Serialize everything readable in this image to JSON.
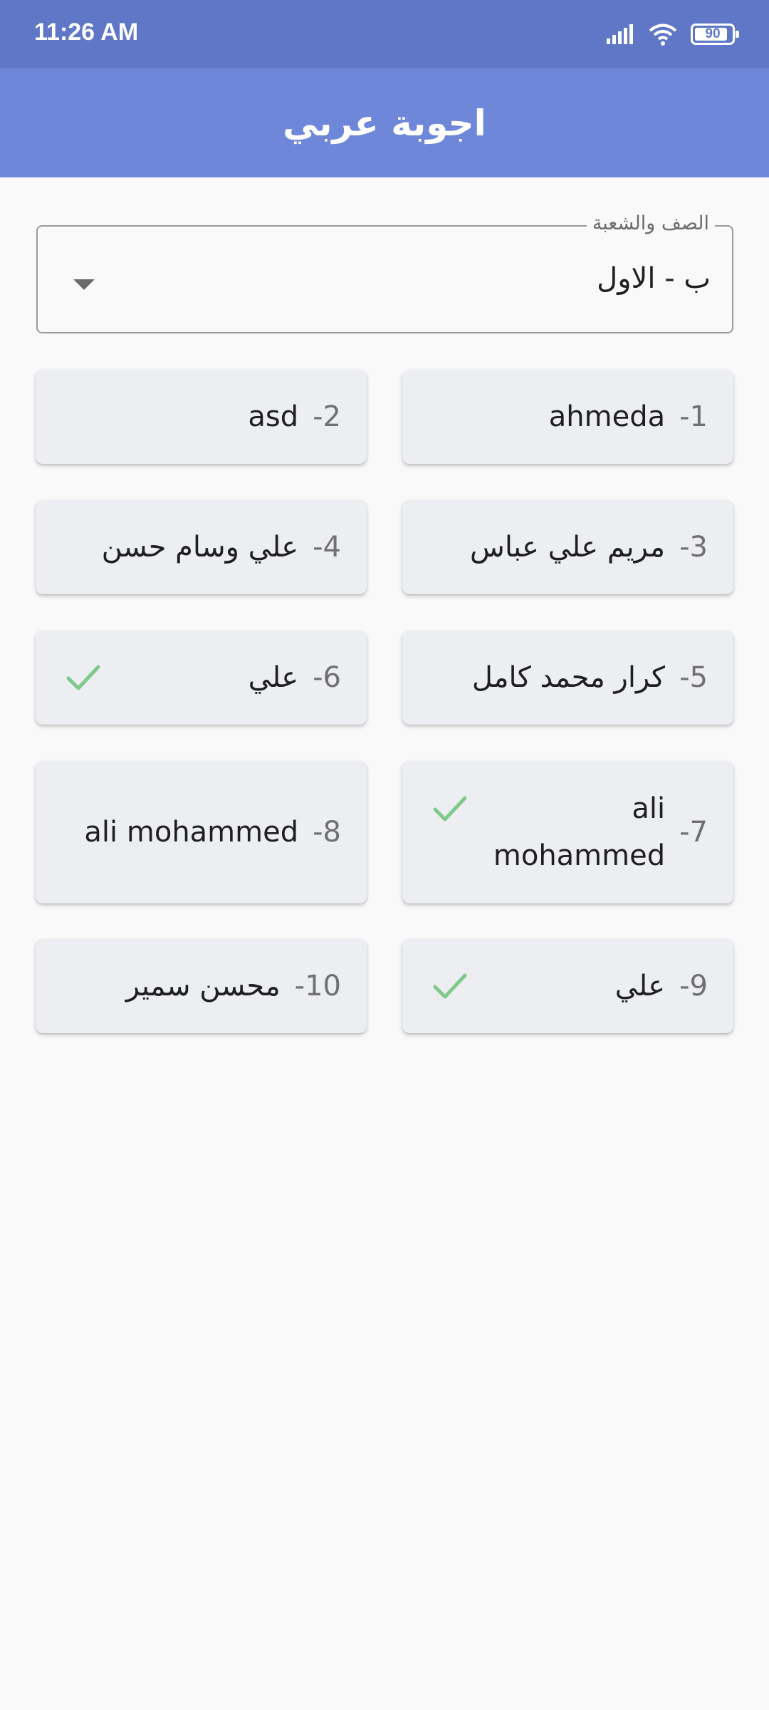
{
  "status_bar": {
    "time": "11:26 AM",
    "battery_level": "90",
    "signal_icon": "signal-bars-icon",
    "wifi_icon": "wifi-icon",
    "battery_icon": "battery-icon"
  },
  "app_bar": {
    "title": "اجوبة عربي"
  },
  "class_select": {
    "label": "الصف والشعبة",
    "value": "ب - الاول",
    "icon": "dropdown-arrow-icon"
  },
  "students": [
    {
      "number": "1-",
      "name": "ahmeda",
      "checked": false
    },
    {
      "number": "2-",
      "name": "asd",
      "checked": false
    },
    {
      "number": "3-",
      "name": "مريم علي عباس",
      "checked": false
    },
    {
      "number": "4-",
      "name": "علي وسام حسن",
      "checked": false
    },
    {
      "number": "5-",
      "name": "كرار محمد كامل",
      "checked": false
    },
    {
      "number": "6-",
      "name": "علي",
      "checked": true
    },
    {
      "number": "7-",
      "name_line1": "ali",
      "name_line2": "mohammed",
      "checked": true
    },
    {
      "number": "8-",
      "name": "ali mohammed",
      "checked": false
    },
    {
      "number": "9-",
      "name": "علي",
      "checked": true
    },
    {
      "number": "10-",
      "name": "محسن سمير",
      "checked": false
    }
  ],
  "colors": {
    "status_bar": "#5f77c6",
    "app_bar": "#6f87d8",
    "card_background": "#eceef2",
    "check": "#7fca8b"
  }
}
